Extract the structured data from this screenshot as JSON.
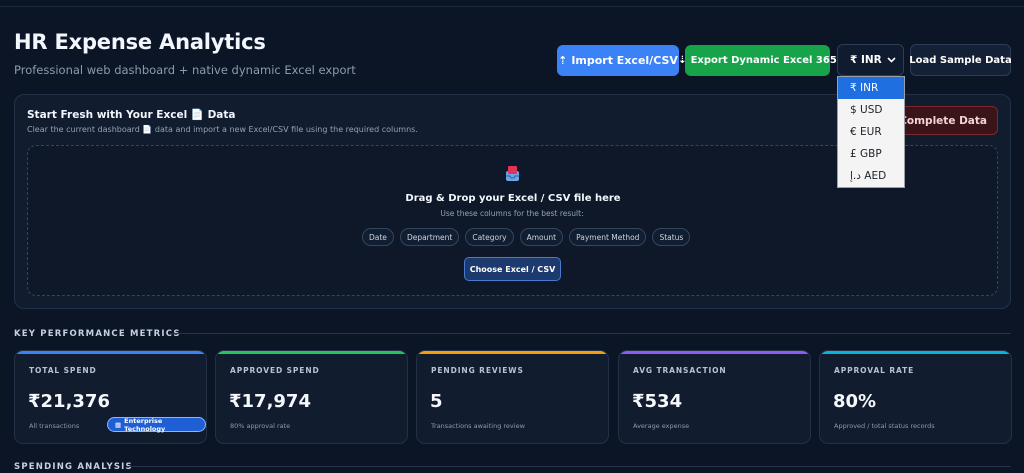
{
  "header": {
    "title": "HR Expense Analytics",
    "subtitle": "Professional web dashboard + native dynamic Excel export"
  },
  "toolbar": {
    "import_label": "Import Excel/CSV",
    "export_label": "Export Dynamic Excel 365",
    "currency_selected": "₹ INR",
    "sample_label": "Load Sample Data",
    "clear_label": "ar Complete Data"
  },
  "currency_options": [
    "₹ INR",
    "$ USD",
    "€ EUR",
    "£ GBP",
    "د.إ AED"
  ],
  "upload": {
    "heading": "Start Fresh with Your Excel 📄 Data",
    "description": "Clear the current dashboard 📄 data and import a new Excel/CSV file using the required columns.",
    "drop_title": "Drag & Drop your Excel / CSV file here",
    "drop_hint": "Use these columns for the best result:",
    "columns": [
      "Date",
      "Department",
      "Category",
      "Amount",
      "Payment Method",
      "Status"
    ],
    "choose_label": "Choose Excel / CSV"
  },
  "sections": {
    "kpi": "KEY PERFORMANCE METRICS",
    "spending": "SPENDING ANALYSIS"
  },
  "kpis": [
    {
      "label": "TOTAL SPEND",
      "value": "₹21,376",
      "sub": "All transactions",
      "color": "#3b82f6",
      "badge": "Enterprise Technology"
    },
    {
      "label": "APPROVED SPEND",
      "value": "₹17,974",
      "sub": "80% approval rate",
      "color": "#22c55e"
    },
    {
      "label": "PENDING REVIEWS",
      "value": "5",
      "sub": "Transactions awaiting review",
      "color": "#f59e0b"
    },
    {
      "label": "AVG TRANSACTION",
      "value": "₹534",
      "sub": "Average expense",
      "color": "#8b5cf6"
    },
    {
      "label": "APPROVAL RATE",
      "value": "80%",
      "sub": "Approved / total status records",
      "color": "#06b6d4"
    }
  ]
}
